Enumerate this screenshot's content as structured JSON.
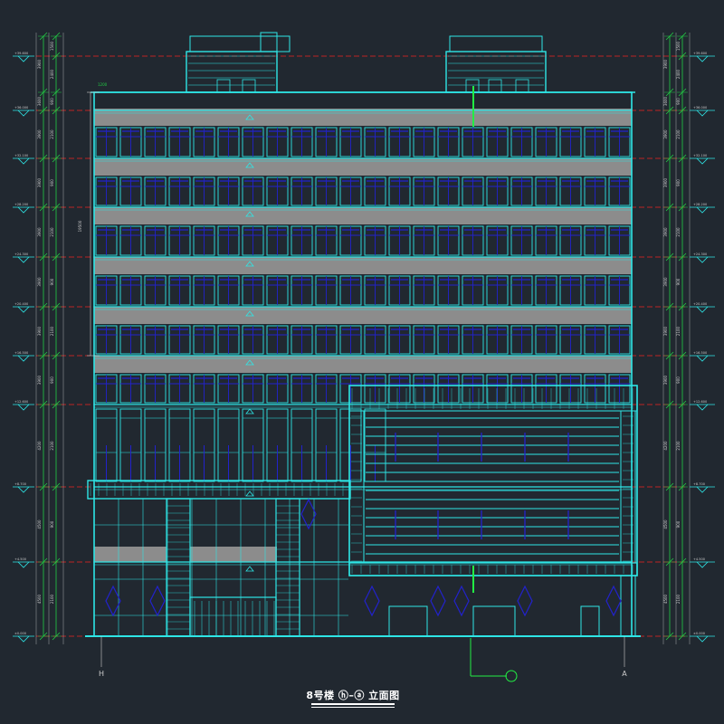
{
  "drawing": {
    "title": "8号楼 ⓗ–ⓐ 立面图",
    "colors": {
      "background": "#212830",
      "outline": "#2ee6e6",
      "glazing": "#2222cc",
      "spandrel": "#8c8c8c",
      "floor_line": "#ee2222",
      "dimension": "#22cc44",
      "marker": "#22ee44"
    },
    "axis_labels": {
      "left": "H",
      "right": "A"
    },
    "level_marks": [
      "+39.600",
      "+36.000",
      "+32.100",
      "+28.200",
      "+24.300",
      "+20.400",
      "+16.500",
      "+12.600",
      "+8.700",
      "+4.500",
      "±0.000"
    ],
    "dimensions": {
      "left_outer": [
        "3900",
        "3600",
        "3900",
        "3900",
        "3900",
        "3900",
        "3900",
        "3900",
        "4200",
        "4500",
        "4500"
      ],
      "left_inner": [
        "1500",
        "2400",
        "900",
        "2100",
        "900",
        "2100",
        "900",
        "2100",
        "900",
        "2100",
        "900",
        "2100",
        "1200"
      ],
      "right_outer": [
        "3900",
        "3600",
        "3900",
        "3900",
        "3900",
        "3900",
        "3900",
        "3900",
        "4200",
        "4500",
        "4500"
      ],
      "right_inner": [
        "1500",
        "2400",
        "900",
        "2100",
        "900",
        "2100",
        "900",
        "2100",
        "900",
        "2100",
        "900",
        "2100",
        "1200"
      ],
      "parapet_callout": "1200",
      "glazing_height": "19500"
    }
  }
}
